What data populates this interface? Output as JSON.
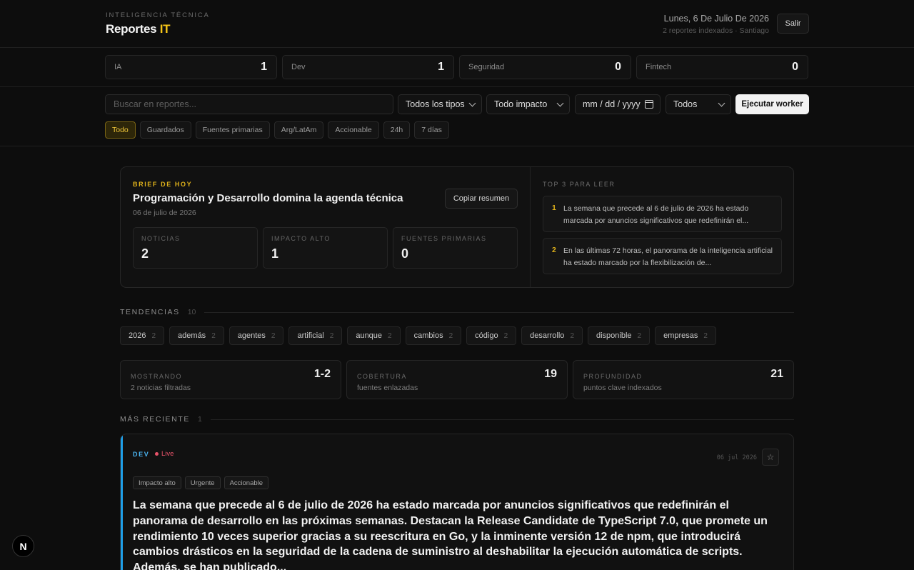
{
  "header": {
    "eyebrow": "INTELIGENCIA TÉCNICA",
    "title_main": "Reportes",
    "title_accent": "IT",
    "date": "Lunes, 6 De Julio De 2026",
    "subtitle": "2 reportes indexados · Santiago",
    "logout_label": "Salir"
  },
  "stats": [
    {
      "label": "IA",
      "value": "1"
    },
    {
      "label": "Dev",
      "value": "1"
    },
    {
      "label": "Seguridad",
      "value": "0"
    },
    {
      "label": "Fintech",
      "value": "0"
    }
  ],
  "filters": {
    "search_placeholder": "Buscar en reportes...",
    "type_select": "Todos los tipos",
    "impact_select": "Todo impacto",
    "date_placeholder": "mm / dd / yyyy",
    "status_select": "Todos",
    "run_label": "Ejecutar worker",
    "chips": [
      "Todo",
      "Guardados",
      "Fuentes primarias",
      "Arg/LatAm",
      "Accionable",
      "24h",
      "7 días"
    ],
    "active_chip": "Todo"
  },
  "brief": {
    "tag": "BRIEF DE HOY",
    "title": "Programación y Desarrollo domina la agenda técnica",
    "date": "06 de julio de 2026",
    "copy_label": "Copiar resumen",
    "metrics": [
      {
        "label": "NOTICIAS",
        "value": "2"
      },
      {
        "label": "IMPACTO ALTO",
        "value": "1"
      },
      {
        "label": "FUENTES PRIMARIAS",
        "value": "0"
      }
    ],
    "top_title": "TOP 3 PARA LEER",
    "top": [
      {
        "n": "1",
        "text": "La semana que precede al 6 de julio de 2026 ha estado marcada por anuncios significativos que redefinirán el..."
      },
      {
        "n": "2",
        "text": "En las últimas 72 horas, el panorama de la inteligencia artificial ha estado marcado por la flexibilización de..."
      }
    ]
  },
  "trends": {
    "title": "TENDENCIAS",
    "count": "10",
    "items": [
      {
        "word": "2026",
        "count": "2"
      },
      {
        "word": "además",
        "count": "2"
      },
      {
        "word": "agentes",
        "count": "2"
      },
      {
        "word": "artificial",
        "count": "2"
      },
      {
        "word": "aunque",
        "count": "2"
      },
      {
        "word": "cambios",
        "count": "2"
      },
      {
        "word": "código",
        "count": "2"
      },
      {
        "word": "desarrollo",
        "count": "2"
      },
      {
        "word": "disponible",
        "count": "2"
      },
      {
        "word": "empresas",
        "count": "2"
      }
    ]
  },
  "info": [
    {
      "label": "MOSTRANDO",
      "sub": "2 noticias filtradas",
      "value": "1-2"
    },
    {
      "label": "COBERTURA",
      "sub": "fuentes enlazadas",
      "value": "19"
    },
    {
      "label": "PROFUNDIDAD",
      "sub": "puntos clave indexados",
      "value": "21"
    }
  ],
  "recent": {
    "title": "MÁS RECIENTE",
    "count": "1"
  },
  "news": {
    "category": "DEV",
    "live": "Live",
    "date": "06 jul 2026",
    "tags": [
      "Impacto alto",
      "Urgente",
      "Accionable"
    ],
    "body": "La semana que precede al 6 de julio de 2026 ha estado marcada por anuncios significativos que redefinirán el panorama de desarrollo en las próximas semanas. Destacan la Release Candidate de TypeScript 7.0, que promete un rendimiento 10 veces superior gracias a su reescritura en Go, y la inminente versión 12 de npm, que introducirá cambios drásticos en la seguridad de la cadena de suministro al deshabilitar la ejecución automática de scripts. Además, se han publicado..."
  },
  "colors": {
    "accent_gold": "#f5c518",
    "dev_blue": "#1f9fe8",
    "live_red": "#e8536a"
  },
  "icons": {
    "date_picker": "calendar-icon",
    "save": "star-icon",
    "framework": "next-logo-icon"
  },
  "fab_label": "N"
}
